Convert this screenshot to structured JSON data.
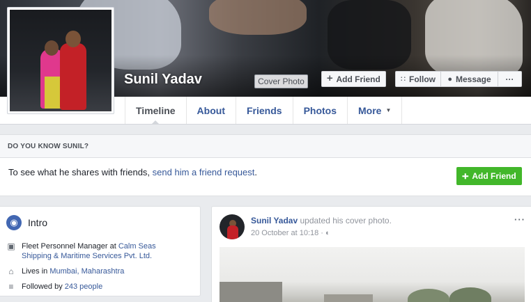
{
  "profile": {
    "name": "Sunil Yadav",
    "cover_photo_label": "Cover Photo"
  },
  "actions": {
    "add_friend": "Add Friend",
    "follow": "Follow",
    "message": "Message",
    "more": "···"
  },
  "tabs": [
    {
      "label": "Timeline"
    },
    {
      "label": "About"
    },
    {
      "label": "Friends"
    },
    {
      "label": "Photos"
    },
    {
      "label": "More"
    }
  ],
  "do_you_know": {
    "heading": "DO YOU KNOW SUNIL?",
    "text_prefix": "To see what he shares with friends, ",
    "link": "send him a friend request",
    "text_suffix": ".",
    "button": "Add Friend"
  },
  "intro": {
    "title": "Intro",
    "work_prefix": "Fleet Personnel Manager at ",
    "work_link": "Calm Seas Shipping & Maritime Services Pvt. Ltd.",
    "lives_prefix": "Lives in ",
    "lives_link": "Mumbai, Maharashtra",
    "followed_prefix": "Followed by ",
    "followed_link": "243 people"
  },
  "post": {
    "author": "Sunil Yadav",
    "action": " updated his cover photo.",
    "date": "20 October at 10:18",
    "separator": " · ",
    "options": "···"
  },
  "colors": {
    "link": "#365899",
    "green": "#42b72a",
    "brand": "#4267b2"
  }
}
